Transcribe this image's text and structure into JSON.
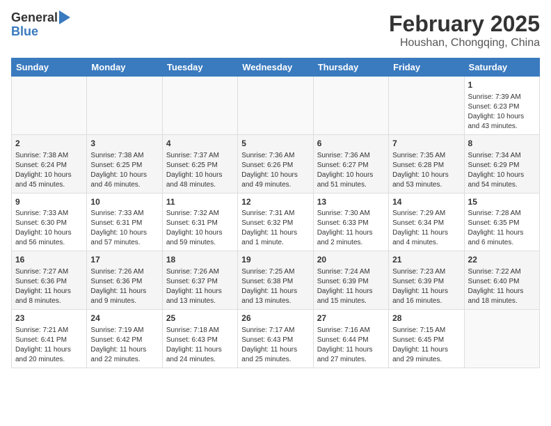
{
  "header": {
    "logo_line1": "General",
    "logo_line2": "Blue",
    "title": "February 2025",
    "subtitle": "Houshan, Chongqing, China"
  },
  "weekdays": [
    "Sunday",
    "Monday",
    "Tuesday",
    "Wednesday",
    "Thursday",
    "Friday",
    "Saturday"
  ],
  "weeks": [
    [
      {
        "day": "",
        "info": ""
      },
      {
        "day": "",
        "info": ""
      },
      {
        "day": "",
        "info": ""
      },
      {
        "day": "",
        "info": ""
      },
      {
        "day": "",
        "info": ""
      },
      {
        "day": "",
        "info": ""
      },
      {
        "day": "1",
        "info": "Sunrise: 7:39 AM\nSunset: 6:23 PM\nDaylight: 10 hours and 43 minutes."
      }
    ],
    [
      {
        "day": "2",
        "info": "Sunrise: 7:38 AM\nSunset: 6:24 PM\nDaylight: 10 hours and 45 minutes."
      },
      {
        "day": "3",
        "info": "Sunrise: 7:38 AM\nSunset: 6:25 PM\nDaylight: 10 hours and 46 minutes."
      },
      {
        "day": "4",
        "info": "Sunrise: 7:37 AM\nSunset: 6:25 PM\nDaylight: 10 hours and 48 minutes."
      },
      {
        "day": "5",
        "info": "Sunrise: 7:36 AM\nSunset: 6:26 PM\nDaylight: 10 hours and 49 minutes."
      },
      {
        "day": "6",
        "info": "Sunrise: 7:36 AM\nSunset: 6:27 PM\nDaylight: 10 hours and 51 minutes."
      },
      {
        "day": "7",
        "info": "Sunrise: 7:35 AM\nSunset: 6:28 PM\nDaylight: 10 hours and 53 minutes."
      },
      {
        "day": "8",
        "info": "Sunrise: 7:34 AM\nSunset: 6:29 PM\nDaylight: 10 hours and 54 minutes."
      }
    ],
    [
      {
        "day": "9",
        "info": "Sunrise: 7:33 AM\nSunset: 6:30 PM\nDaylight: 10 hours and 56 minutes."
      },
      {
        "day": "10",
        "info": "Sunrise: 7:33 AM\nSunset: 6:31 PM\nDaylight: 10 hours and 57 minutes."
      },
      {
        "day": "11",
        "info": "Sunrise: 7:32 AM\nSunset: 6:31 PM\nDaylight: 10 hours and 59 minutes."
      },
      {
        "day": "12",
        "info": "Sunrise: 7:31 AM\nSunset: 6:32 PM\nDaylight: 11 hours and 1 minute."
      },
      {
        "day": "13",
        "info": "Sunrise: 7:30 AM\nSunset: 6:33 PM\nDaylight: 11 hours and 2 minutes."
      },
      {
        "day": "14",
        "info": "Sunrise: 7:29 AM\nSunset: 6:34 PM\nDaylight: 11 hours and 4 minutes."
      },
      {
        "day": "15",
        "info": "Sunrise: 7:28 AM\nSunset: 6:35 PM\nDaylight: 11 hours and 6 minutes."
      }
    ],
    [
      {
        "day": "16",
        "info": "Sunrise: 7:27 AM\nSunset: 6:36 PM\nDaylight: 11 hours and 8 minutes."
      },
      {
        "day": "17",
        "info": "Sunrise: 7:26 AM\nSunset: 6:36 PM\nDaylight: 11 hours and 9 minutes."
      },
      {
        "day": "18",
        "info": "Sunrise: 7:26 AM\nSunset: 6:37 PM\nDaylight: 11 hours and 13 minutes."
      },
      {
        "day": "19",
        "info": "Sunrise: 7:25 AM\nSunset: 6:38 PM\nDaylight: 11 hours and 13 minutes."
      },
      {
        "day": "20",
        "info": "Sunrise: 7:24 AM\nSunset: 6:39 PM\nDaylight: 11 hours and 15 minutes."
      },
      {
        "day": "21",
        "info": "Sunrise: 7:23 AM\nSunset: 6:39 PM\nDaylight: 11 hours and 16 minutes."
      },
      {
        "day": "22",
        "info": "Sunrise: 7:22 AM\nSunset: 6:40 PM\nDaylight: 11 hours and 18 minutes."
      }
    ],
    [
      {
        "day": "23",
        "info": "Sunrise: 7:21 AM\nSunset: 6:41 PM\nDaylight: 11 hours and 20 minutes."
      },
      {
        "day": "24",
        "info": "Sunrise: 7:19 AM\nSunset: 6:42 PM\nDaylight: 11 hours and 22 minutes."
      },
      {
        "day": "25",
        "info": "Sunrise: 7:18 AM\nSunset: 6:43 PM\nDaylight: 11 hours and 24 minutes."
      },
      {
        "day": "26",
        "info": "Sunrise: 7:17 AM\nSunset: 6:43 PM\nDaylight: 11 hours and 25 minutes."
      },
      {
        "day": "27",
        "info": "Sunrise: 7:16 AM\nSunset: 6:44 PM\nDaylight: 11 hours and 27 minutes."
      },
      {
        "day": "28",
        "info": "Sunrise: 7:15 AM\nSunset: 6:45 PM\nDaylight: 11 hours and 29 minutes."
      },
      {
        "day": "",
        "info": ""
      }
    ]
  ]
}
